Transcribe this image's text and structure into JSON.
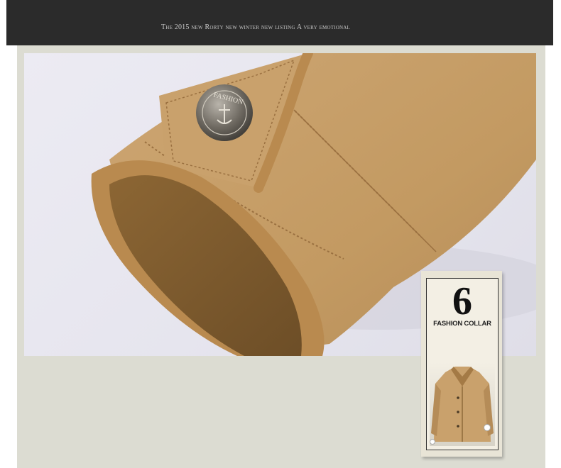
{
  "banner": {
    "text": "The 2015 new Rorty new winter new listing  A very emotional"
  },
  "photo": {
    "subject": "jacket-sleeve-cuff-with-fur-lining",
    "button_text": "FASHION"
  },
  "feature_card": {
    "number": "6",
    "label": "FASHION COLLAR"
  },
  "colors": {
    "banner_bg": "#2b2b2b",
    "panel_bg": "#dcdcd2",
    "fabric": "#c8a06a",
    "fur": "#b98a4f"
  }
}
